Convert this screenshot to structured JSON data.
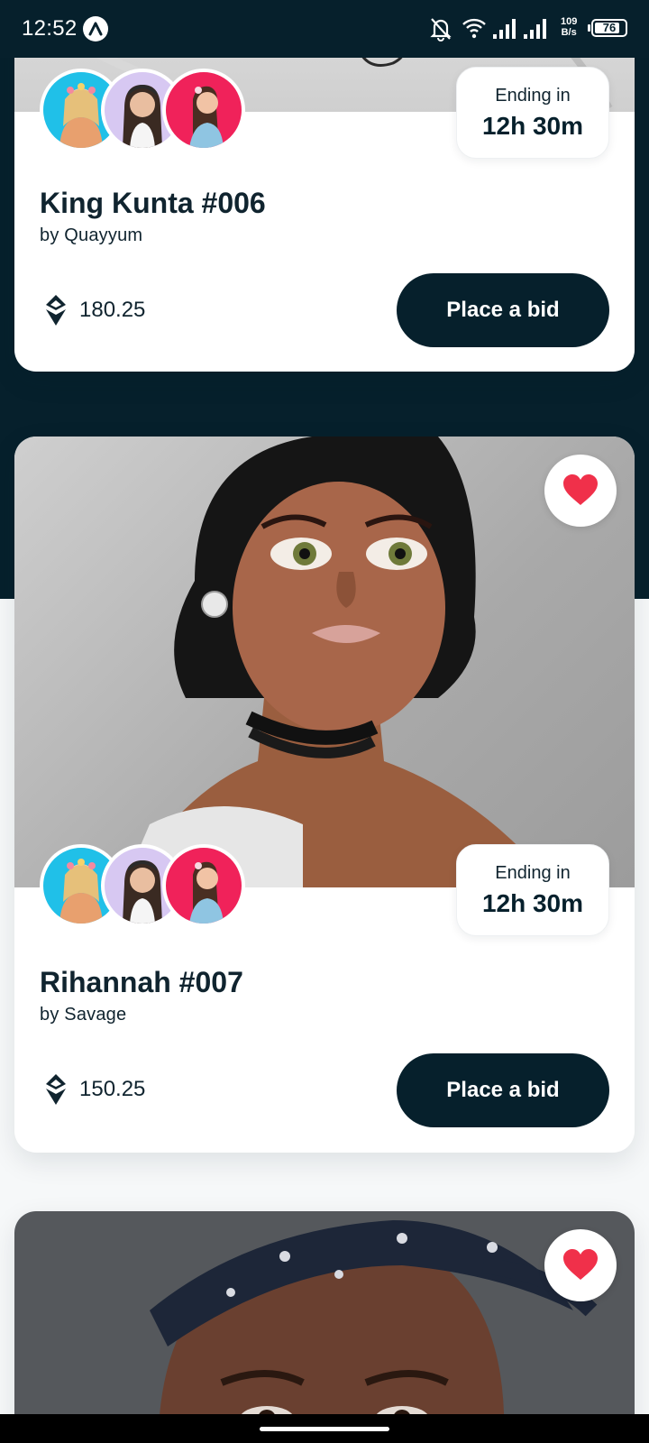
{
  "status_bar": {
    "time": "12:52",
    "net_speed_value": "109",
    "net_speed_unit": "B/s",
    "battery_level": "76",
    "icons": [
      "app-badge-icon",
      "silent-bell-icon",
      "wifi-icon",
      "signal-icon",
      "signal-icon"
    ]
  },
  "colors": {
    "primary_dark": "#06202c",
    "heart_red": "#f0304a",
    "card_bg": "#ffffff"
  },
  "cards": [
    {
      "title": "King Kunta #006",
      "creator": "by Quayyum",
      "ending_label": "Ending in",
      "ending_time": "12h 30m",
      "price": "180.25",
      "bid_label": "Place a bid",
      "price_icon": "eth-icon",
      "favorite_icon": "heart-icon"
    },
    {
      "title": "Rihannah #007",
      "creator": "by Savage",
      "ending_label": "Ending in",
      "ending_time": "12h 30m",
      "price": "150.25",
      "bid_label": "Place a bid",
      "price_icon": "eth-icon",
      "favorite_icon": "heart-icon"
    },
    {
      "favorite_icon": "heart-icon"
    }
  ]
}
